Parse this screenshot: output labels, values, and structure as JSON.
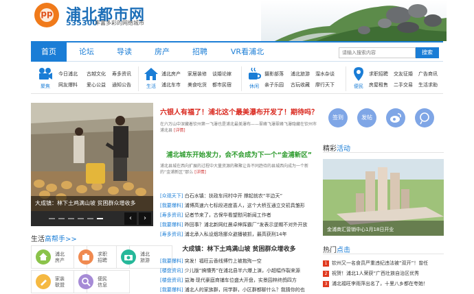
{
  "header": {
    "logo_mark": "pp",
    "site_name": "浦北都市网",
    "site_number": "535300",
    "slogan": "丰富多彩的网络城市"
  },
  "nav": {
    "items": [
      "首页",
      "论坛",
      "导读",
      "房产",
      "招聘",
      "VR看浦北"
    ],
    "active": "首页",
    "search_placeholder": "请输入搜索内容",
    "search_button": "搜索"
  },
  "services": [
    {
      "label": "聚焦",
      "icon": "video-camera-icon",
      "links": [
        "今日浦北",
        "古越文化",
        "寿多资讯",
        "网友爆料",
        "爱心公益",
        "通知公告"
      ]
    },
    {
      "label": "生活",
      "icon": "house-icon",
      "links": [
        "浦北房产",
        "家居装修",
        "谈婚论嫁",
        "浦北车市",
        "美食吃货",
        "都市民宿"
      ]
    },
    {
      "label": "休闲",
      "icon": "coffee-cup-icon",
      "links": [
        "摄影部落",
        "浦北旅游",
        "溜水杂谈",
        "亲子乐园",
        "古玩收藏",
        "摩行天下"
      ]
    },
    {
      "label": "便民",
      "icon": "location-pin-icon",
      "links": [
        "求职招聘",
        "交友征婚",
        "广告商讯",
        "房屋租售",
        "二手交易",
        "生活求助"
      ]
    }
  ],
  "slider": {
    "caption": "大成镇：林下土鸡满山坡 贫困群众增收多",
    "prev": "‹",
    "next": "›",
    "dots": 6,
    "active_dot": 5
  },
  "life": {
    "title_plain": "生活",
    "title_accent": "高帮手>>",
    "items": [
      {
        "l1": "浦北",
        "l2": "房产",
        "color": "#8bc34a",
        "icon": "house-icon"
      },
      {
        "l1": "求职",
        "l2": "招聘",
        "color": "#f08a50",
        "icon": "briefcase-icon"
      },
      {
        "l1": "浦北",
        "l2": "旅游",
        "color": "#26b89a",
        "icon": "camera-icon"
      },
      {
        "l1": "家装",
        "l2": "联盟",
        "color": "#f5b942",
        "icon": "paint-brush-icon"
      },
      {
        "l1": "便民",
        "l2": "信息",
        "color": "#a68bd6",
        "icon": "search-icon"
      }
    ]
  },
  "news": {
    "headline1": "六银人有福了！浦北这个最美瀑布开发了！期待吗？",
    "summary1": "在六万山中深藏着钦州第一飞瀑也是浦北最美瀑布——翠峰飞瀑翠峰飞瀑隐藏在钦州市浦北县",
    "detail": "[详情]",
    "headline2": "浦北城东开始发力，会不会成为下一个“金浦新区”",
    "summary2": "浦北县城在西向扩展的过程中大量资源的聚聚让各不同趋待的县城西向成为一个新的“金浦新区”那么",
    "list": [
      {
        "cat": "[众观天下]",
        "text": "白石水镇：扶政车间村中开 撑起就农“半边天”"
      },
      {
        "cat": "[我要爆料]",
        "text": "浦博高速六七标段进度喜人，这个大桥互通立交初具雏形"
      },
      {
        "cat": "[寿多资讯]",
        "text": "记者节来了，古保华看望慰问新闻工作者"
      },
      {
        "cat": "[我要爆料]",
        "text": "昨回事？浦北新网红晨卓绅挥霸厂”发表示逆期不对外开放"
      },
      {
        "cat": "[寿多资讯]",
        "text": "浦北承入私设烟场挪众避播被抓，最高获刑14年"
      }
    ],
    "headline3": "大成镇：林下土鸡满山坡 贫困群众增收多",
    "list2": [
      {
        "cat": "[我要爆料]",
        "text": "突发！福旺云香线博竹上被抱殉一空"
      },
      {
        "cat": "[楼盘资讯]",
        "text": "少儿版“搞懵秀”在浦北县半六爆上演，小超幅作裂来源"
      },
      {
        "cat": "[楼盘资讯]",
        "text": "益海·现代豪庭商铺车位盛大开盘，实景园林终鸽四方"
      },
      {
        "cat": "[我要爆料]",
        "text": "浦北人的家族群，同学群，小区群都聊什么？我猜你的也"
      }
    ]
  },
  "social": [
    "签到",
    "发帖",
    "微博",
    "分享"
  ],
  "activity": {
    "title_plain": "精彩",
    "title_accent": "活动",
    "caption": "金浦商汇营销中心1月18日开业"
  },
  "hot": {
    "title_plain": "热门",
    "title_accent": "点击",
    "items": [
      "钦州又一名食员严重违纪违法被“双开”！曾任",
      "祝贺！浦北1人荣获“广西壮族自治区优秀",
      "浦北福旺李雨萍出名了，十里八乡都在夸她！"
    ]
  }
}
